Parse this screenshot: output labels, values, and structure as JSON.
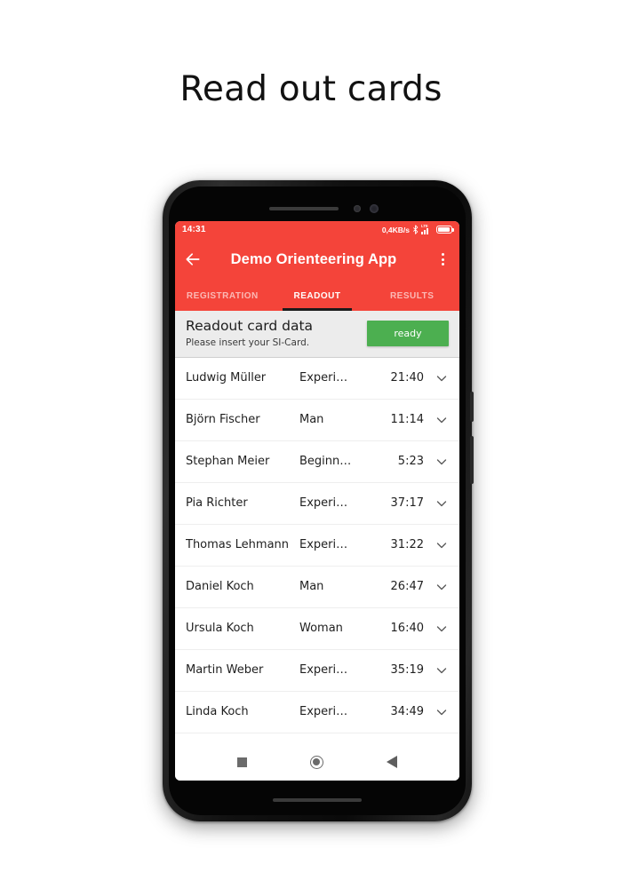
{
  "page": {
    "title": "Read out cards"
  },
  "status_bar": {
    "time": "14:31",
    "network_speed": "0,4KB/s",
    "bluetooth_icon": "bluetooth-icon",
    "network_type": "LTE",
    "signal_icon": "signal-bars-icon",
    "battery_icon": "battery-full-icon"
  },
  "app_bar": {
    "back_icon": "back-arrow-icon",
    "title": "Demo Orienteering App",
    "overflow_icon": "overflow-menu-icon"
  },
  "tabs": [
    {
      "label": "REGISTRATION",
      "active": false
    },
    {
      "label": "READOUT",
      "active": true
    },
    {
      "label": "RESULTS",
      "active": false
    }
  ],
  "readout_card": {
    "title": "Readout card data",
    "subtitle": "Please insert your SI-Card.",
    "status_button": "ready"
  },
  "card_list": {
    "rows": [
      {
        "name": "Ludwig Müller",
        "category": "Experi…",
        "time": "21:40",
        "chevron": "chevron-down-icon"
      },
      {
        "name": "Björn Fischer",
        "category": "Man",
        "time": "11:14",
        "chevron": "chevron-down-icon"
      },
      {
        "name": "Stephan Meier",
        "category": "Beginn…",
        "time": "5:23",
        "chevron": "chevron-down-icon"
      },
      {
        "name": "Pia Richter",
        "category": "Experi…",
        "time": "37:17",
        "chevron": "chevron-down-icon"
      },
      {
        "name": "Thomas Lehmann",
        "category": "Experi…",
        "time": "31:22",
        "chevron": "chevron-down-icon"
      },
      {
        "name": "Daniel Koch",
        "category": "Man",
        "time": "26:47",
        "chevron": "chevron-down-icon"
      },
      {
        "name": "Ursula Koch",
        "category": "Woman",
        "time": "16:40",
        "chevron": "chevron-down-icon"
      },
      {
        "name": "Martin Weber",
        "category": "Experi…",
        "time": "35:19",
        "chevron": "chevron-down-icon"
      },
      {
        "name": "Linda Koch",
        "category": "Experi…",
        "time": "34:49",
        "chevron": "chevron-down-icon"
      }
    ]
  },
  "nav_bar": {
    "recents_icon": "recents-square-icon",
    "home_icon": "home-circle-icon",
    "back_icon": "back-triangle-icon"
  },
  "colors": {
    "accent_red": "#F4443A",
    "status_green": "#4CAF50",
    "card_gray": "#ECECEC"
  }
}
